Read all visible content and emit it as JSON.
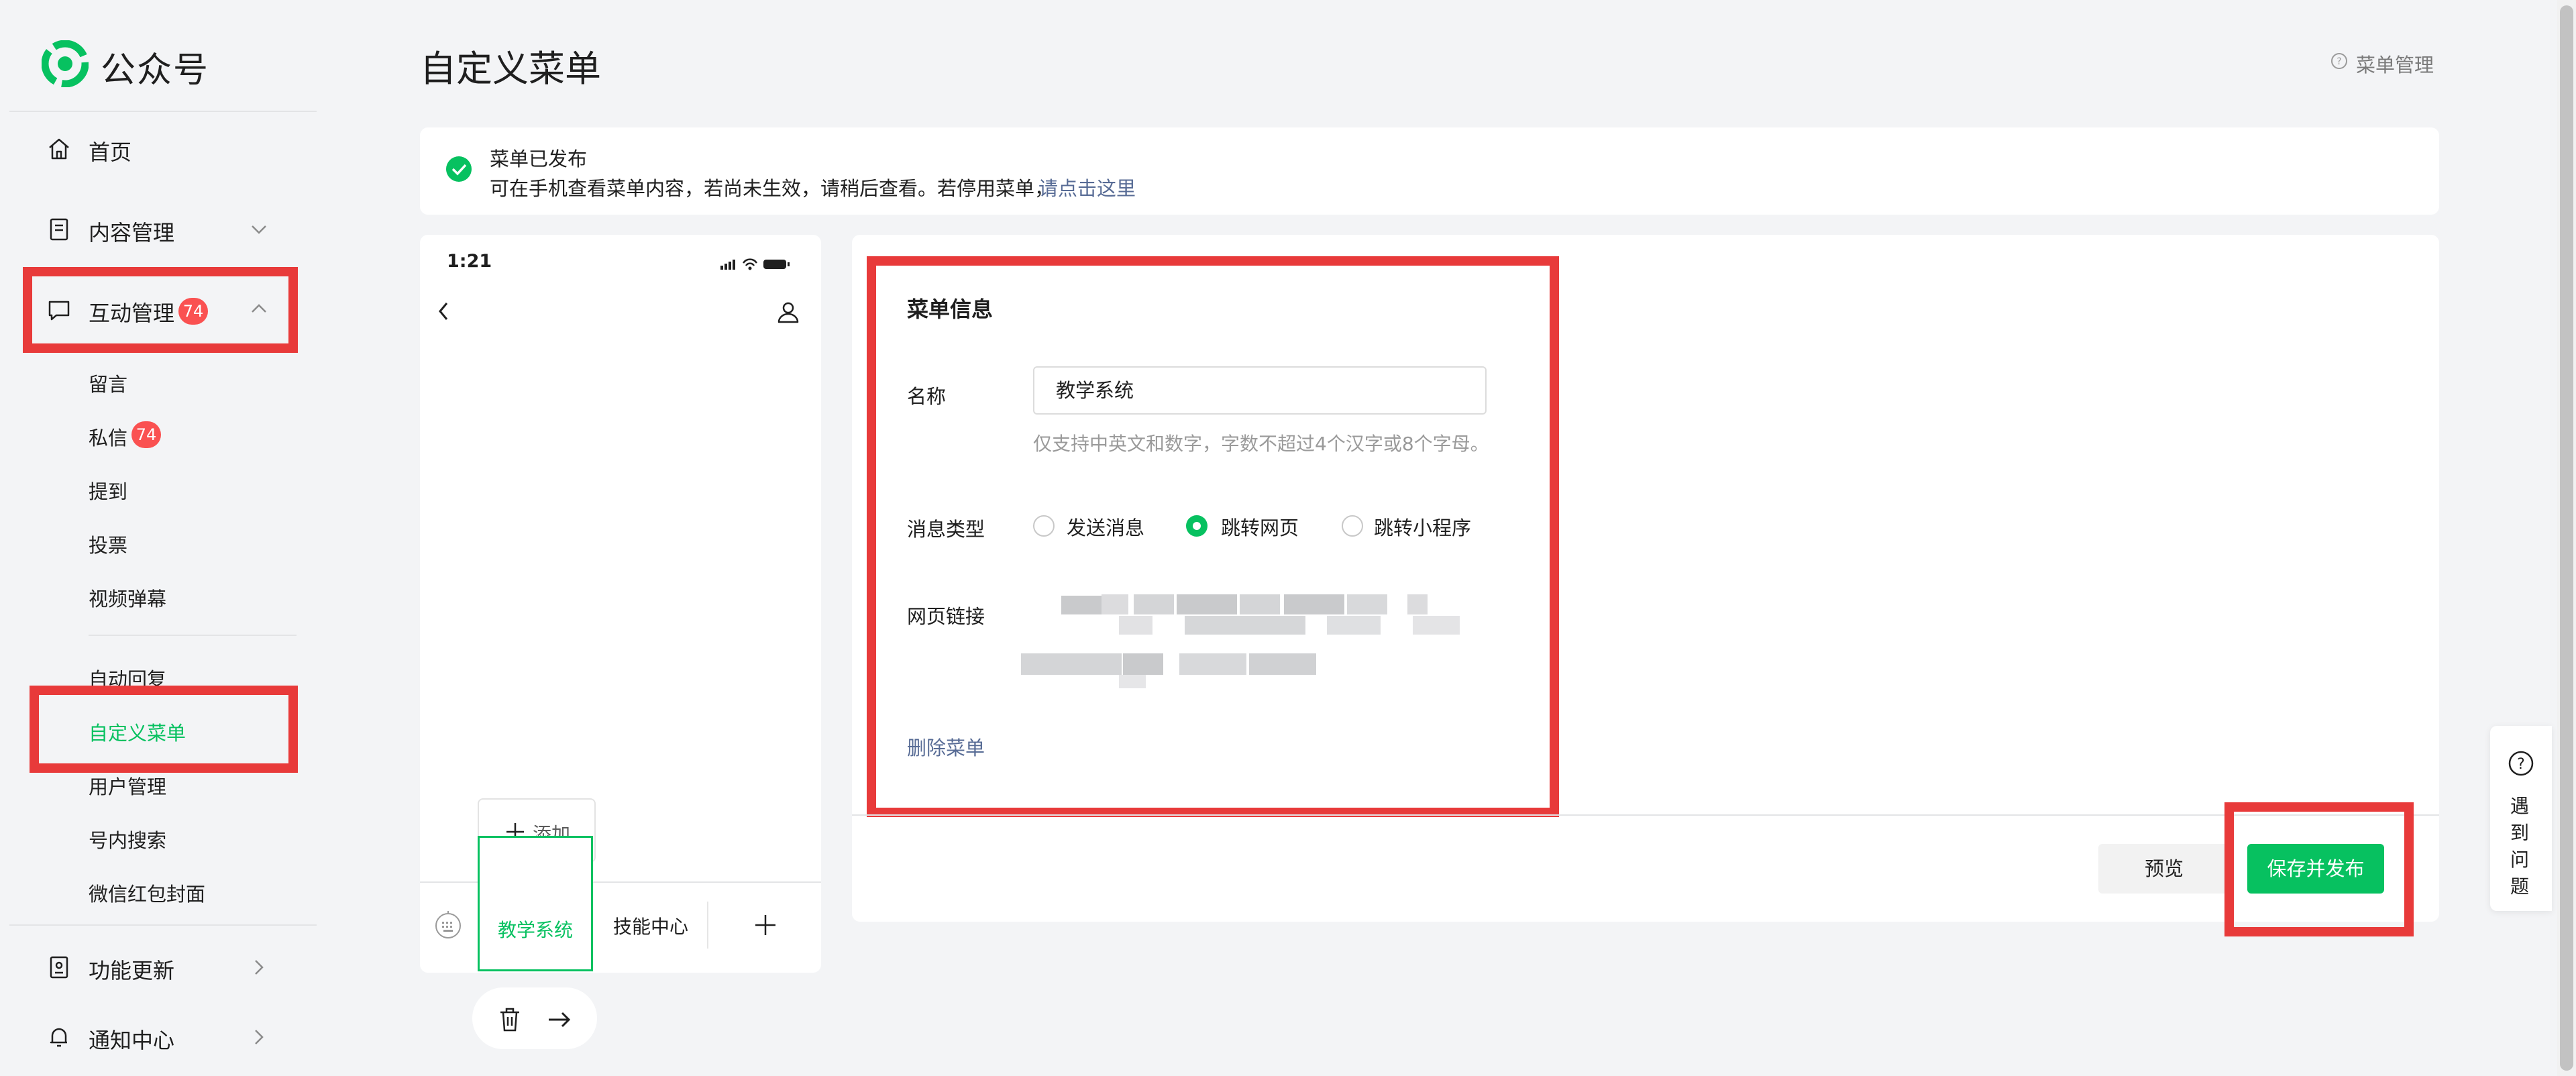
{
  "app": {
    "name": "公众号"
  },
  "sidebar": {
    "home": "首页",
    "content": "内容管理",
    "interaction": {
      "label": "互动管理",
      "badge": "74"
    },
    "sub": {
      "comments": "留言",
      "messages": "私信",
      "messages_badge": "74",
      "mentions": "提到",
      "vote": "投票",
      "danmaku": "视频弹幕",
      "auto_reply": "自动回复",
      "custom_menu": "自定义菜单",
      "users": "用户管理",
      "search": "号内搜索",
      "red_packet": "微信红包封面"
    },
    "updates": "功能更新",
    "notices": "通知中心"
  },
  "header": {
    "title": "自定义菜单",
    "help": "菜单管理"
  },
  "notice": {
    "title": "菜单已发布",
    "desc": "可在手机查看菜单内容，若尚未生效，请稍后查看。若停用菜单，",
    "link": "请点击这里"
  },
  "phone": {
    "time": "1:21",
    "add_label": "添加",
    "tabs": [
      "教学系统",
      "技能中心"
    ]
  },
  "form": {
    "section_title": "菜单信息",
    "name_label": "名称",
    "name_value": "教学系统",
    "name_hint": "仅支持中英文和数字，字数不超过4个汉字或8个字母。",
    "type_label": "消息类型",
    "type_options": [
      "发送消息",
      "跳转网页",
      "跳转小程序"
    ],
    "type_selected": "跳转网页",
    "url_label": "网页链接",
    "delete": "删除菜单"
  },
  "buttons": {
    "preview": "预览",
    "save": "保存并发布"
  },
  "float_help": {
    "chars": [
      "遇",
      "到",
      "问",
      "题"
    ]
  },
  "colors": {
    "accent": "#07c160",
    "highlight": "#e83a3a",
    "link": "#576b95",
    "badge": "#fa5151"
  }
}
